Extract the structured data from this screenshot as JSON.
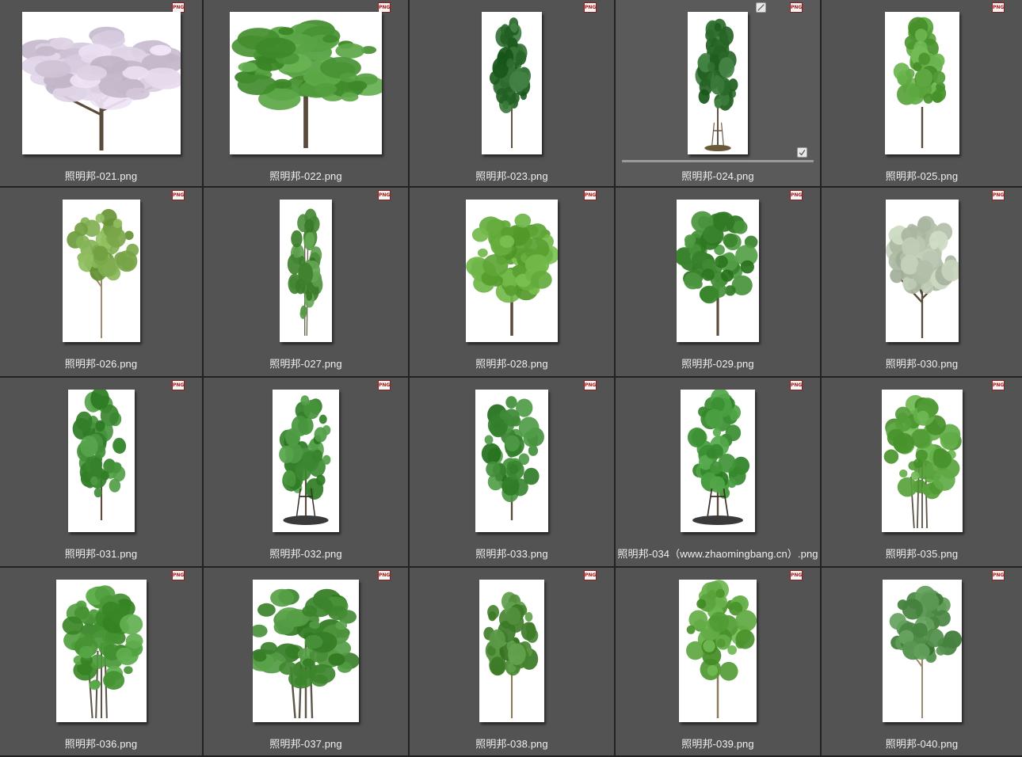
{
  "badge_text": "PNG",
  "colors": {
    "grid_line": "#222222",
    "cell_bg": "#535353",
    "label_text": "#f0f0f0",
    "badge_border": "#8a1d1d"
  },
  "selected_index": 3,
  "selected_item": {
    "progress": 1.0,
    "controls": [
      "no-preview-icon",
      "checkbox-check-icon"
    ]
  },
  "items": [
    {
      "name": "照明邦-021.png",
      "w": 200,
      "tree": {
        "type": "blossom",
        "color": "#d9cde0"
      }
    },
    {
      "name": "照明邦-022.png",
      "w": 192,
      "tree": {
        "type": "spread",
        "color": "#4f9a3a"
      }
    },
    {
      "name": "照明邦-023.png",
      "w": 76,
      "tree": {
        "type": "conical",
        "color": "#2d6b2e"
      }
    },
    {
      "name": "照明邦-024.png",
      "w": 76,
      "tree": {
        "type": "conical-staked",
        "color": "#2f6e2f"
      }
    },
    {
      "name": "照明邦-025.png",
      "w": 94,
      "tree": {
        "type": "conical",
        "color": "#5da640"
      }
    },
    {
      "name": "照明邦-026.png",
      "w": 98,
      "tree": {
        "type": "sparse",
        "color": "#7aa84a"
      }
    },
    {
      "name": "照明邦-027.png",
      "w": 66,
      "tree": {
        "type": "slender",
        "color": "#4d8f3c"
      }
    },
    {
      "name": "照明邦-028.png",
      "w": 116,
      "tree": {
        "type": "round",
        "color": "#64ab3c"
      }
    },
    {
      "name": "照明邦-029.png",
      "w": 104,
      "tree": {
        "type": "round",
        "color": "#3f8a32"
      }
    },
    {
      "name": "照明邦-030.png",
      "w": 92,
      "tree": {
        "type": "blossom",
        "color": "#b9c6b0"
      }
    },
    {
      "name": "照明邦-031.png",
      "w": 84,
      "tree": {
        "type": "tall",
        "color": "#3f8c35"
      }
    },
    {
      "name": "照明邦-032.png",
      "w": 84,
      "tree": {
        "type": "tall-staked",
        "color": "#3f8c35"
      }
    },
    {
      "name": "照明邦-033.png",
      "w": 92,
      "tree": {
        "type": "tall",
        "color": "#3a8632"
      }
    },
    {
      "name": "照明邦-034（www.zhaomingbang.cn）.png",
      "w": 94,
      "tree": {
        "type": "tall-staked",
        "color": "#3f9336"
      }
    },
    {
      "name": "照明邦-035.png",
      "w": 102,
      "tree": {
        "type": "multi",
        "color": "#5aa43e"
      }
    },
    {
      "name": "照明邦-036.png",
      "w": 114,
      "tree": {
        "type": "multi",
        "color": "#4c9a3a"
      }
    },
    {
      "name": "照明邦-037.png",
      "w": 134,
      "tree": {
        "type": "multi-wide",
        "color": "#468e36"
      }
    },
    {
      "name": "照明邦-038.png",
      "w": 82,
      "tree": {
        "type": "palmate",
        "color": "#4c8a36"
      }
    },
    {
      "name": "照明邦-039.png",
      "w": 98,
      "tree": {
        "type": "palmate",
        "color": "#5aa33c"
      }
    },
    {
      "name": "照明邦-040.png",
      "w": 100,
      "tree": {
        "type": "sparse",
        "color": "#4f8c48"
      }
    }
  ]
}
